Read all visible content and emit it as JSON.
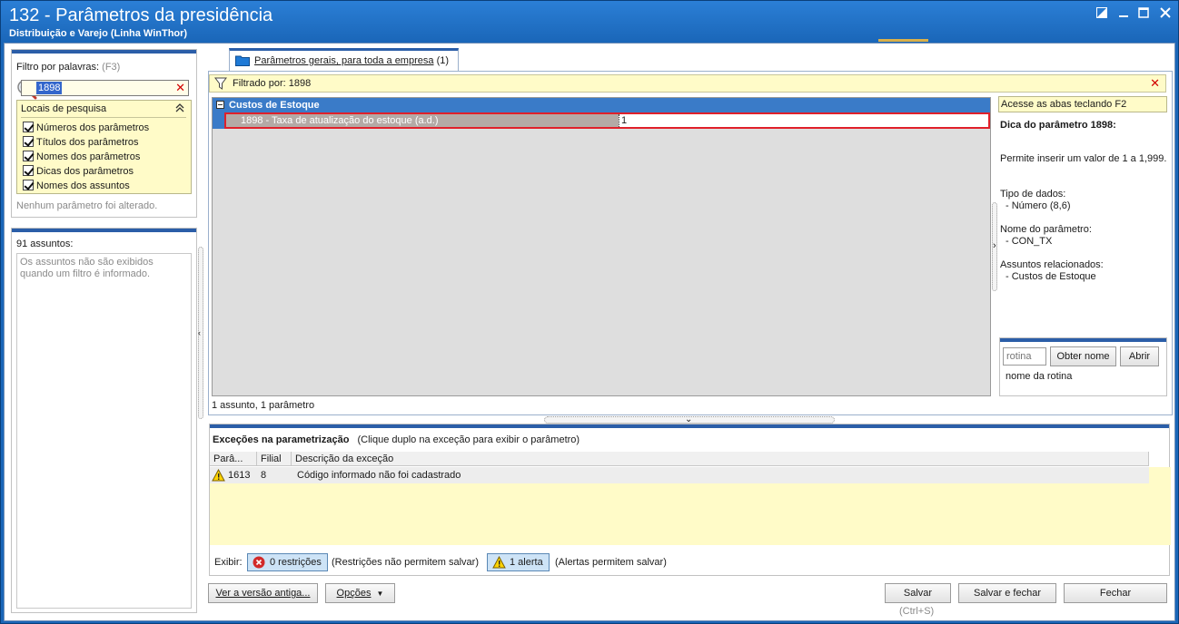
{
  "window": {
    "title": "132 - Parâmetros da presidência",
    "subtitle": "Distribuição e Varejo (Linha WinThor)"
  },
  "filter_panel": {
    "label": "Filtro por palavras:",
    "shortcut": "(F3)",
    "search_value": "1898",
    "locations_title": "Locais de pesquisa",
    "locations": [
      {
        "label": "Números dos parâmetros",
        "checked": true
      },
      {
        "label": "Títulos dos parâmetros",
        "checked": true
      },
      {
        "label": "Nomes dos parâmetros",
        "checked": true
      },
      {
        "label": "Dicas dos parâmetros",
        "checked": true
      },
      {
        "label": "Nomes dos assuntos",
        "checked": true
      }
    ],
    "status": "Nenhum parâmetro foi alterado."
  },
  "subjects_panel": {
    "count_label": "91 assuntos:",
    "message": "Os assuntos não são exibidos quando um filtro é informado."
  },
  "tab": {
    "label": "Parâmetros gerais, para toda a empresa",
    "count": "(1)"
  },
  "filter_bar": {
    "label": "Filtrado por: 1898"
  },
  "grid": {
    "group_label": "Custos de Estoque",
    "row": {
      "name": "1898 - Taxa de atualização do estoque (a.d.)",
      "value": "1"
    },
    "footer": "1 assunto, 1 parâmetro"
  },
  "tip_panel": {
    "hint": "Acesse as abas teclando F2",
    "title": "Dica do parâmetro 1898:",
    "description": "Permite inserir um valor de 1 a 1,999.",
    "data_type_label": "Tipo de dados:",
    "data_type_value": "- Número (8,6)",
    "param_name_label": "Nome do parâmetro:",
    "param_name_value": "- CON_TX",
    "related_label": "Assuntos relacionados:",
    "related_value": "- Custos de Estoque",
    "routine_placeholder": "rotina",
    "get_name_button": "Obter nome",
    "open_button": "Abrir",
    "routine_name_label": "nome da rotina"
  },
  "exceptions": {
    "title": "Exceções na parametrização",
    "hint": "(Clique duplo na exceção para exibir o parâmetro)",
    "columns": [
      "Parâ...",
      "Filial",
      "Descrição da exceção"
    ],
    "rows": [
      {
        "param": "1613",
        "branch": "8",
        "description": "Código informado não foi cadastrado"
      }
    ],
    "show_label": "Exibir:",
    "restrictions_button": "0 restrições",
    "restrictions_note": "(Restrições não permitem salvar)",
    "alerts_button": "1 alerta",
    "alerts_note": "(Alertas permitem salvar)"
  },
  "footer_buttons": {
    "old_version": "Ver a versão antiga...",
    "options": "Opções",
    "save": "Salvar",
    "save_shortcut": "(Ctrl+S)",
    "save_close": "Salvar e fechar",
    "close": "Fechar"
  },
  "colors": {
    "titlebar": "#1a66b8",
    "group_row": "#3a7bc8",
    "highlight_border": "#e0202a",
    "yellow_bg": "#fffbc8"
  }
}
